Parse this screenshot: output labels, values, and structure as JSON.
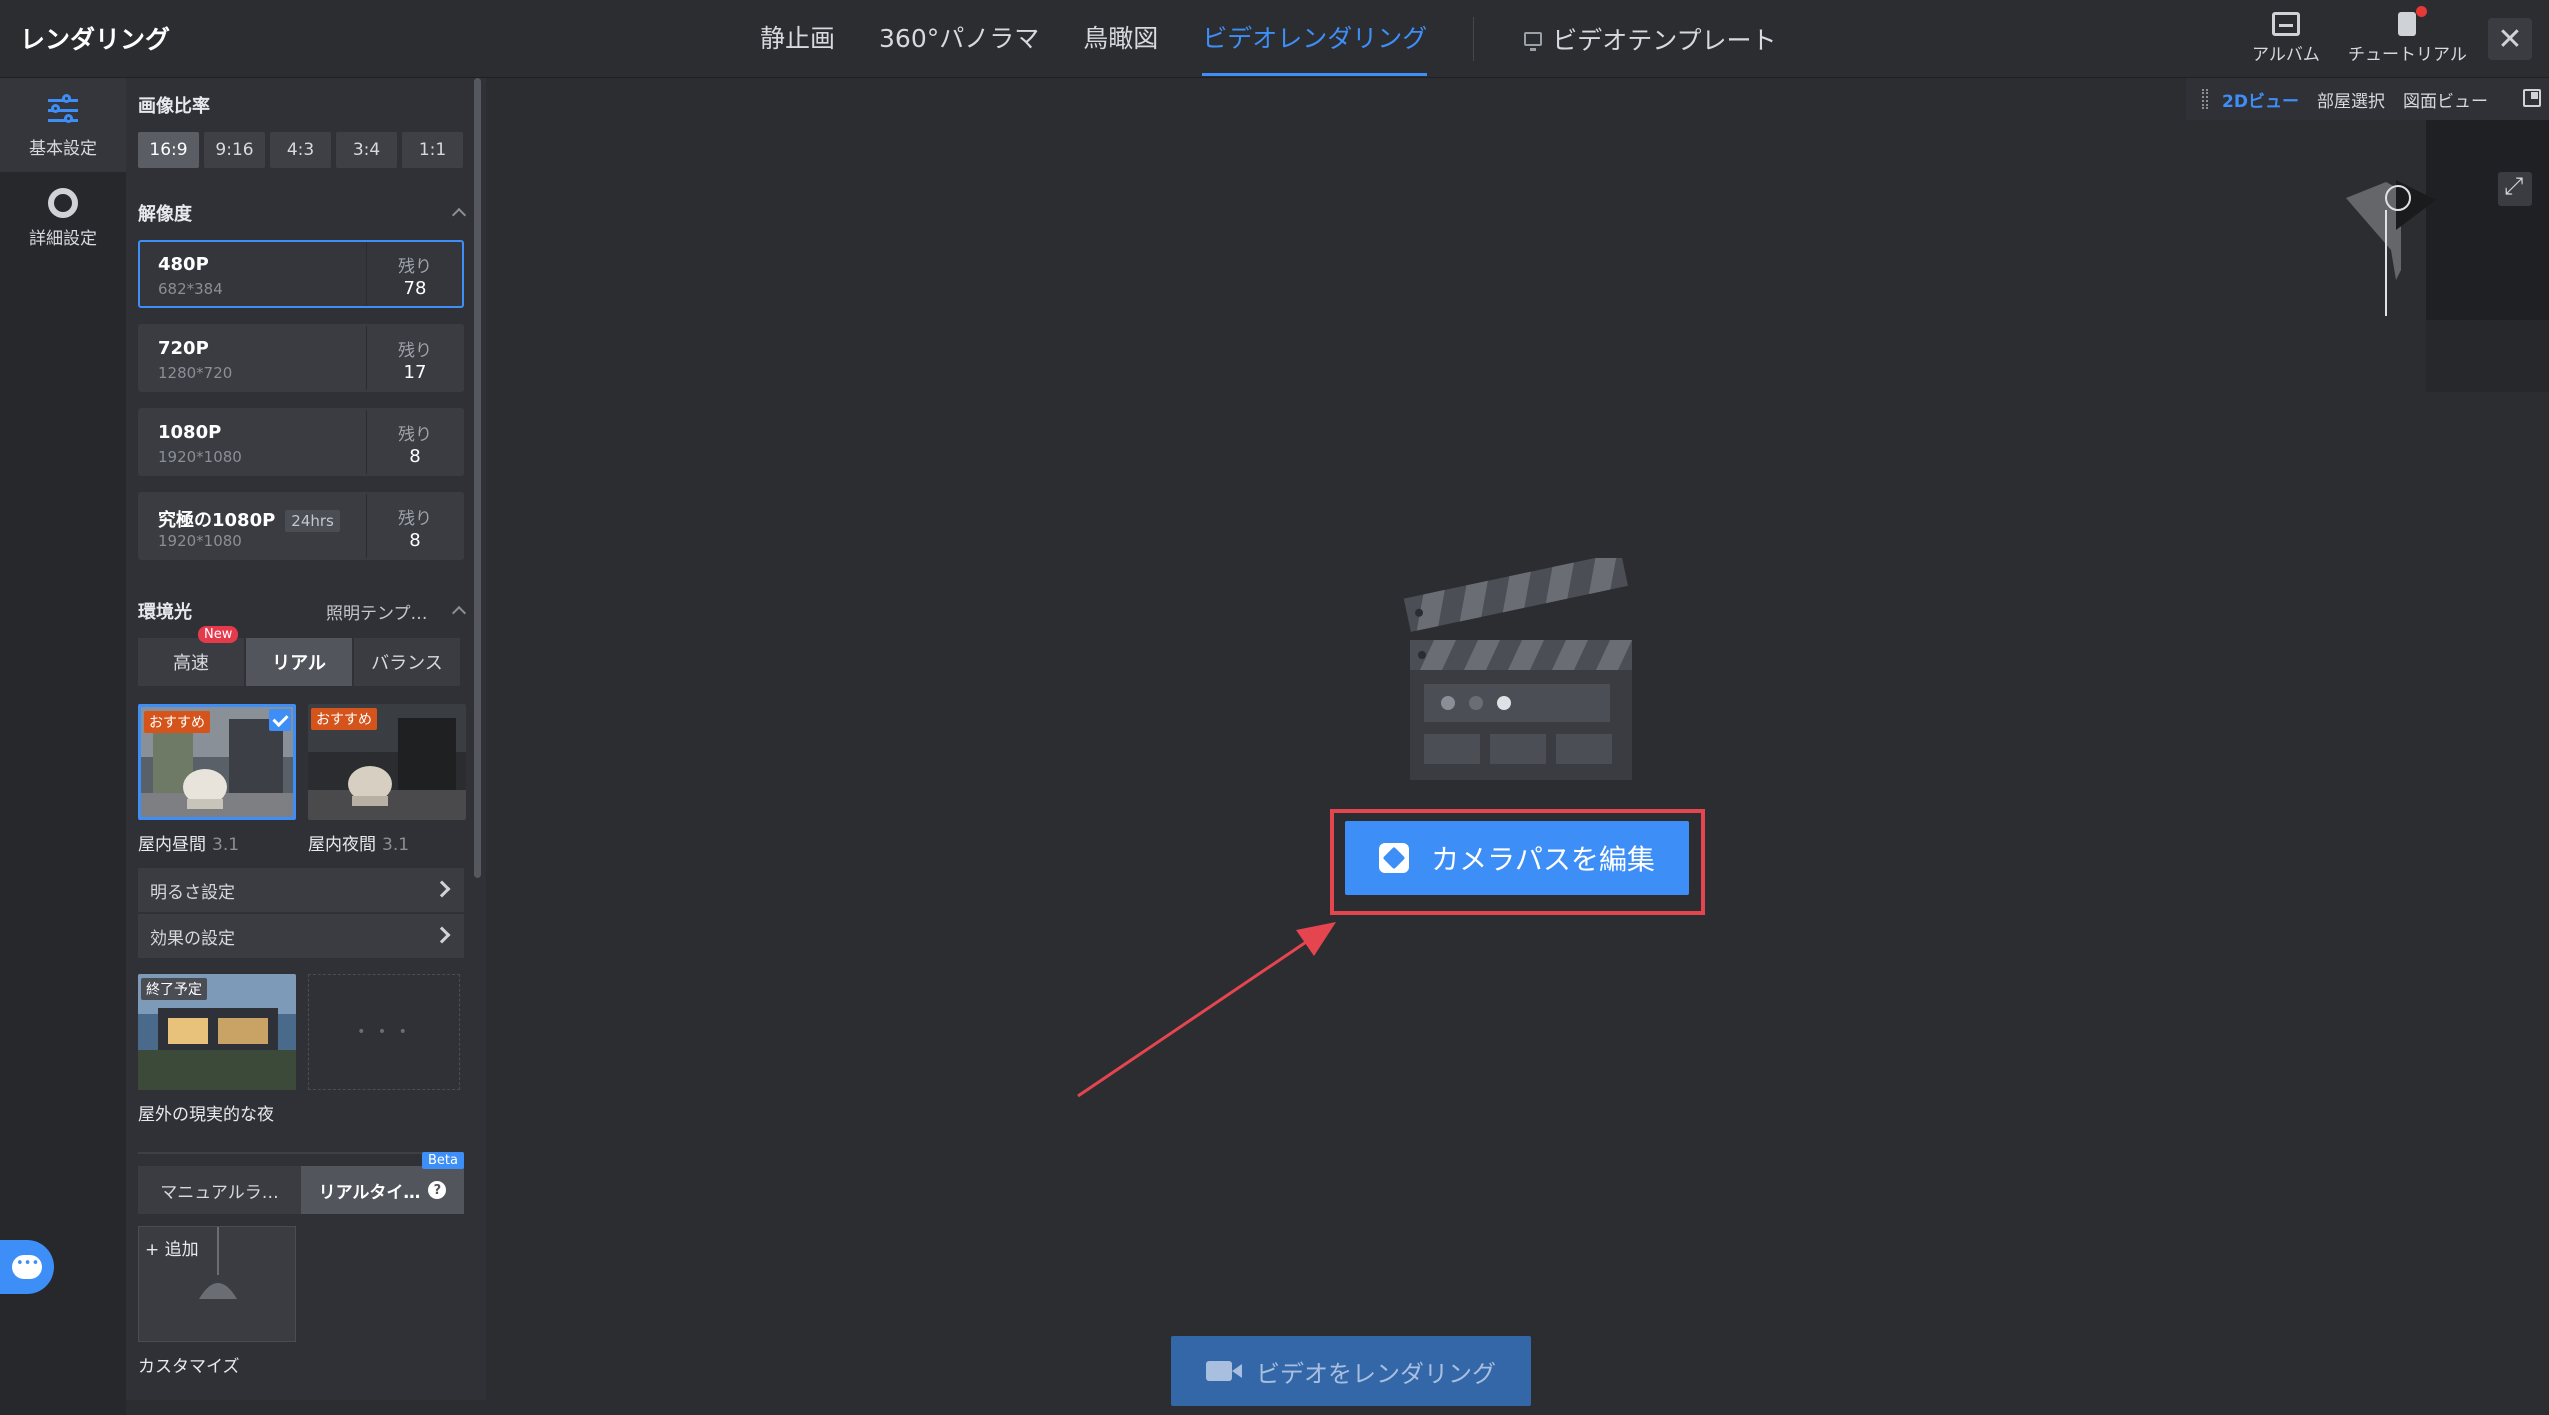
{
  "app": {
    "title": "レンダリング"
  },
  "tabs": [
    {
      "label": "静止画",
      "active": false
    },
    {
      "label": "360°パノラマ",
      "active": false
    },
    {
      "label": "鳥瞰図",
      "active": false
    },
    {
      "label": "ビデオレンダリング",
      "active": true
    }
  ],
  "template_tab": {
    "label": "ビデオテンプレート",
    "icon": "monitor-icon"
  },
  "top_right": {
    "album_label": "アルバム",
    "tutorial_label": "チュートリアル",
    "close_icon": "close-icon"
  },
  "rail": {
    "basic_label": "基本設定",
    "advanced_label": "詳細設定"
  },
  "settings": {
    "aspect_title": "画像比率",
    "aspect_options": [
      "16:9",
      "9:16",
      "4:3",
      "3:4",
      "1:1"
    ],
    "aspect_selected": "16:9",
    "resolution_title": "解像度",
    "remaining_label": "残り",
    "resolutions": [
      {
        "name": "480P",
        "dim": "682*384",
        "remaining": "78",
        "selected": true
      },
      {
        "name": "720P",
        "dim": "1280*720",
        "remaining": "17",
        "selected": false
      },
      {
        "name": "1080P",
        "dim": "1920*1080",
        "remaining": "8",
        "selected": false
      },
      {
        "name": "究極の1080P",
        "badge": "24hrs",
        "dim": "1920*1080",
        "remaining": "8",
        "selected": false
      }
    ],
    "ambient_title": "環境光",
    "lighting_template": "照明テンプ…",
    "light_modes": [
      {
        "label": "高速",
        "badge": "New"
      },
      {
        "label": "リアル",
        "active": true
      },
      {
        "label": "バランス"
      }
    ],
    "presets": [
      {
        "tag": "おすすめ",
        "name": "屋内昼間",
        "version": "3.1",
        "selected": true
      },
      {
        "tag": "おすすめ",
        "name": "屋内夜間",
        "version": "3.1",
        "selected": false
      }
    ],
    "brightness_label": "明るさ設定",
    "effect_label": "効果の設定",
    "scene_presets": [
      {
        "tag": "終了予定",
        "name": "屋外の現実的な夜"
      }
    ],
    "more_dots": "• • •",
    "light_tabs": [
      {
        "label": "マニュアルラ…"
      },
      {
        "label": "リアルタイ…",
        "active": true,
        "badge": "Beta"
      }
    ],
    "add_label": "+ 追加",
    "custom_label": "カスタマイズ"
  },
  "main": {
    "edit_button_label": "カメラパスを編集",
    "render_button_label": "ビデオをレンダリング"
  },
  "mini_map": {
    "views": [
      {
        "label": "2Dビュー",
        "active": true
      },
      {
        "label": "部屋選択"
      },
      {
        "label": "図面ビュー"
      }
    ]
  },
  "colors": {
    "accent": "#3e8ef7",
    "highlight_box": "#e5454f",
    "background": "#2b2d31",
    "panel": "#2f3136"
  }
}
